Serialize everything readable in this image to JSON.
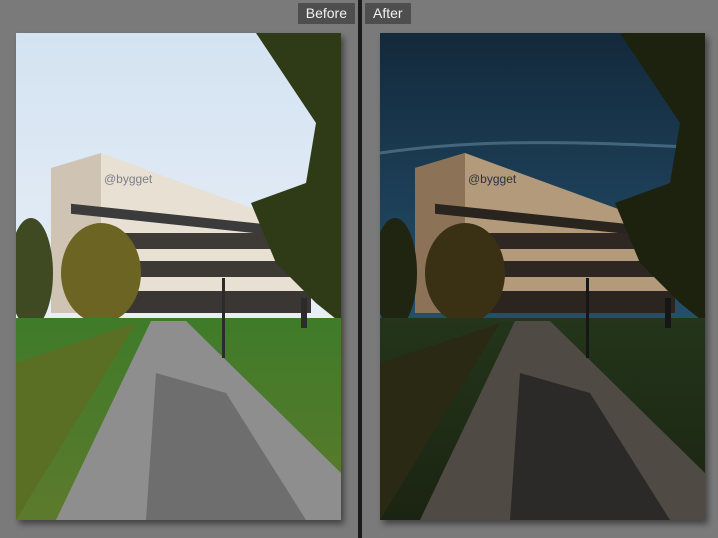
{
  "panels": [
    {
      "id": "before",
      "label": "Before"
    },
    {
      "id": "after",
      "label": "After"
    }
  ],
  "photo": {
    "sign_text": "@bygget",
    "subject": "office building with tree, lawn and path"
  },
  "colors": {
    "background": "#7b7b7b",
    "label_bg": "#4e4e4e",
    "divider": "#1b1b1b",
    "before_sky_top": "#cfe0f1",
    "after_sky_top": "#163247"
  }
}
